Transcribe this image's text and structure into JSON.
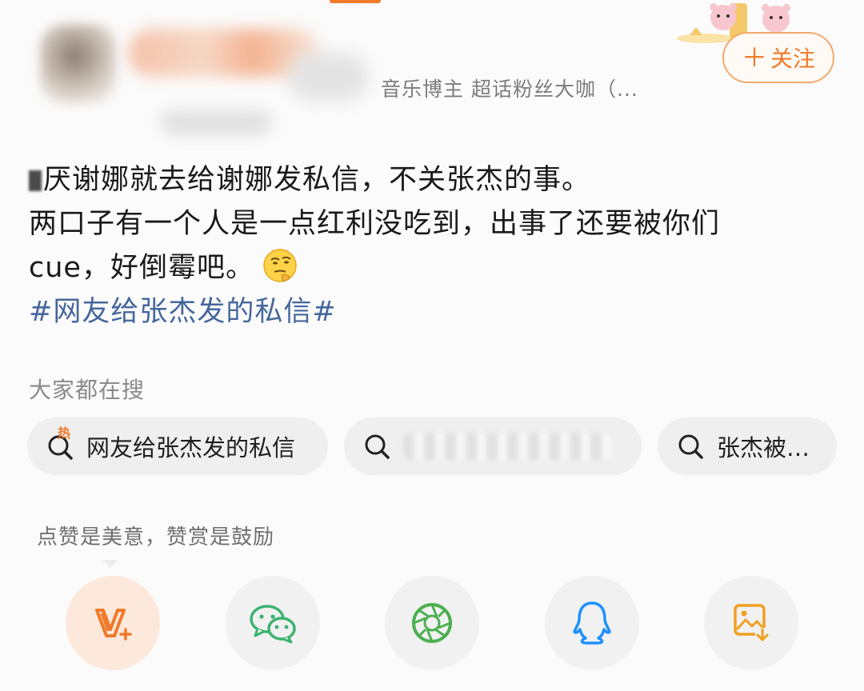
{
  "user": {
    "tags": "音乐博主 超话粉丝大咖（...",
    "follow_label": "关注"
  },
  "post": {
    "line1": "厌谢娜就去给谢娜发私信，不关张杰的事。",
    "line2": "两口子有一个人是一点红利没吃到，出事了还要被你们",
    "line3": "cue，好倒霉吧。",
    "emoji": "thinking-face-emoji",
    "hashtag": "#网友给张杰发的私信#"
  },
  "search": {
    "title": "大家都在搜",
    "hot_label": "热",
    "chips": [
      {
        "label": "网友给张杰发的私信",
        "icon": "hot-search-icon"
      },
      {
        "label": "",
        "icon": "search-icon"
      },
      {
        "label": "张杰被…",
        "icon": "search-icon"
      }
    ]
  },
  "tip": "点赞是美意，赞赏是鼓励",
  "share": [
    {
      "icon": "v-plus-icon",
      "color": "#f07a2a"
    },
    {
      "icon": "wechat-icon",
      "color": "#3cb371"
    },
    {
      "icon": "moments-icon",
      "color": "#4caf50"
    },
    {
      "icon": "qq-icon",
      "color": "#1e90ff"
    },
    {
      "icon": "save-image-icon",
      "color": "#f0a020"
    }
  ],
  "colors": {
    "accent": "#f07a2a",
    "hashtag": "#46679c",
    "chip_bg": "#efefef"
  }
}
